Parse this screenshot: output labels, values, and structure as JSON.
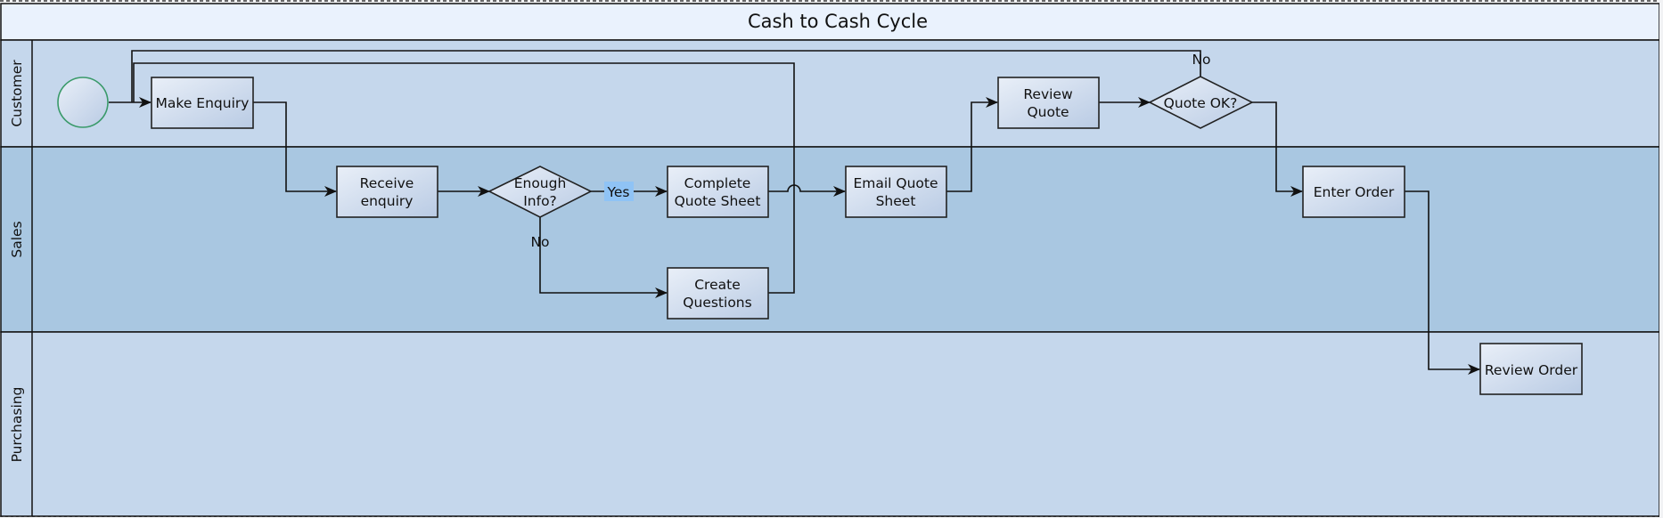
{
  "diagram": {
    "title": "Cash to Cash Cycle",
    "colors": {
      "title_bg": "#eaf2fd",
      "lane_light": "#c5d7ec",
      "lane_dark": "#a9c7e1",
      "node_fill_start": "#e9eff8",
      "node_fill_end": "#b9cbe4",
      "start_event_stroke": "#3a9a6a",
      "yes_label_bg": "#8fc3f5",
      "border": "#111111"
    },
    "lanes": [
      {
        "id": "customer",
        "label": "Customer"
      },
      {
        "id": "sales",
        "label": "Sales"
      },
      {
        "id": "purchasing",
        "label": "Purchasing"
      }
    ],
    "nodes": [
      {
        "id": "start",
        "type": "start-event",
        "lane": "customer",
        "lines": []
      },
      {
        "id": "make-enquiry",
        "type": "task",
        "lane": "customer",
        "lines": [
          "Make Enquiry"
        ]
      },
      {
        "id": "receive-enquiry",
        "type": "task",
        "lane": "sales",
        "lines": [
          "Receive",
          "enquiry"
        ]
      },
      {
        "id": "enough-info",
        "type": "decision",
        "lane": "sales",
        "lines": [
          "Enough",
          "Info?"
        ]
      },
      {
        "id": "complete-quote-sheet",
        "type": "task",
        "lane": "sales",
        "lines": [
          "Complete",
          "Quote Sheet"
        ]
      },
      {
        "id": "create-questions",
        "type": "task",
        "lane": "sales",
        "lines": [
          "Create",
          "Questions"
        ]
      },
      {
        "id": "email-quote-sheet",
        "type": "task",
        "lane": "sales",
        "lines": [
          "Email Quote",
          "Sheet"
        ]
      },
      {
        "id": "review-quote",
        "type": "task",
        "lane": "customer",
        "lines": [
          "Review",
          "Quote"
        ]
      },
      {
        "id": "quote-ok",
        "type": "decision",
        "lane": "customer",
        "lines": [
          "Quote OK?"
        ]
      },
      {
        "id": "enter-order",
        "type": "task",
        "lane": "sales",
        "lines": [
          "Enter Order"
        ]
      },
      {
        "id": "review-order",
        "type": "task",
        "lane": "purchasing",
        "lines": [
          "Review Order"
        ]
      }
    ],
    "edges": [
      {
        "from": "start",
        "to": "make-enquiry",
        "label": ""
      },
      {
        "from": "make-enquiry",
        "to": "receive-enquiry",
        "label": ""
      },
      {
        "from": "receive-enquiry",
        "to": "enough-info",
        "label": ""
      },
      {
        "from": "enough-info",
        "to": "complete-quote-sheet",
        "label": "Yes",
        "highlight": true
      },
      {
        "from": "enough-info",
        "to": "create-questions",
        "label": "No"
      },
      {
        "from": "create-questions",
        "to": "make-enquiry",
        "label": ""
      },
      {
        "from": "complete-quote-sheet",
        "to": "email-quote-sheet",
        "label": ""
      },
      {
        "from": "email-quote-sheet",
        "to": "review-quote",
        "label": ""
      },
      {
        "from": "review-quote",
        "to": "quote-ok",
        "label": ""
      },
      {
        "from": "quote-ok",
        "to": "make-enquiry",
        "label": "No"
      },
      {
        "from": "quote-ok",
        "to": "enter-order",
        "label": ""
      },
      {
        "from": "enter-order",
        "to": "review-order",
        "label": ""
      }
    ]
  }
}
